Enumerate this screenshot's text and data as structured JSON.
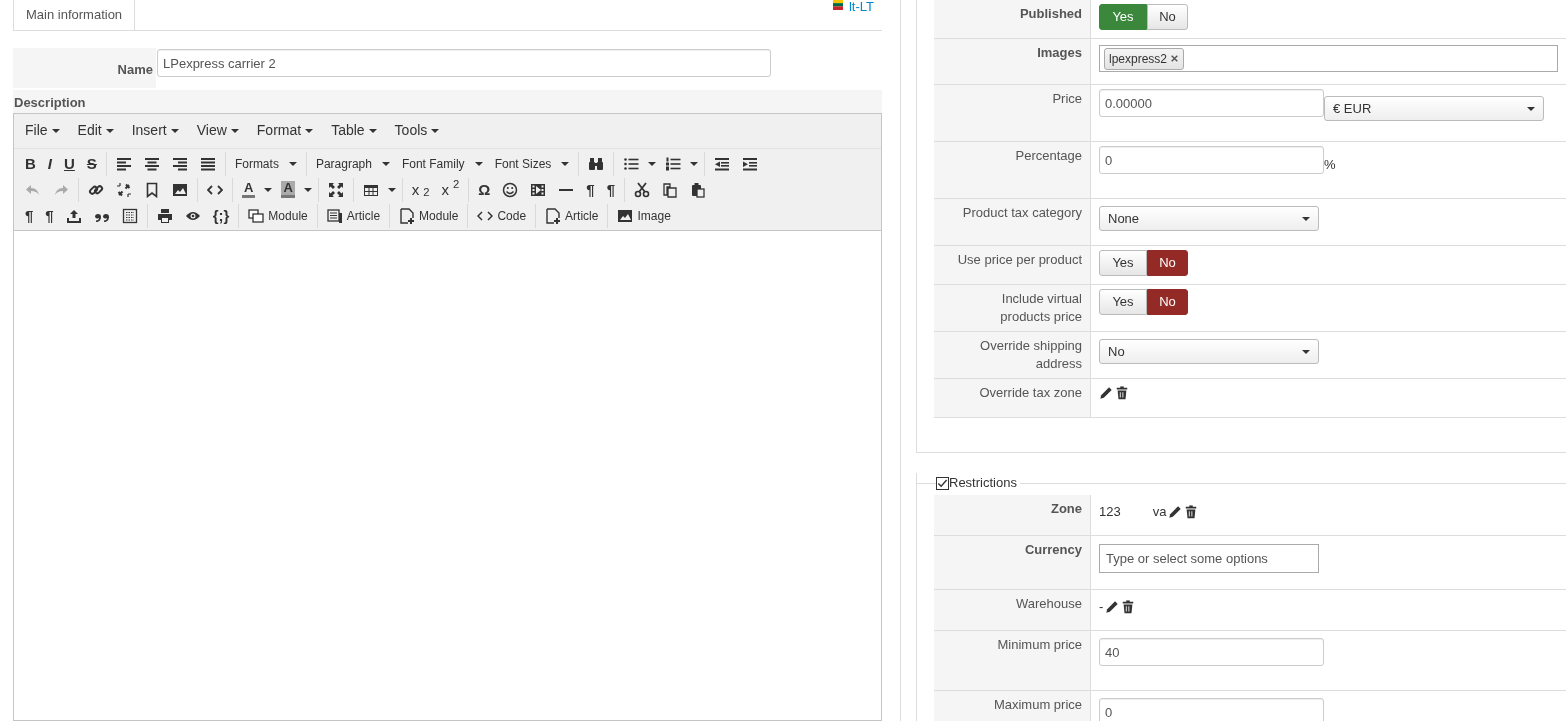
{
  "tabs": [
    {
      "label": "Main information",
      "selected": true
    }
  ],
  "language": {
    "code": "lt-LT"
  },
  "name_field": {
    "label": "Name",
    "value": "LPexpress carrier 2"
  },
  "description": {
    "label": "Description"
  },
  "editor": {
    "menus": [
      "File",
      "Edit",
      "Insert",
      "View",
      "Format",
      "Table",
      "Tools"
    ],
    "toolbar": [
      [
        [
          {
            "kind": "glyph",
            "glyph": "B"
          },
          {
            "kind": "glyph",
            "glyph": "I"
          },
          {
            "kind": "glyph",
            "glyph": "U"
          },
          {
            "kind": "glyph",
            "glyph": "S"
          }
        ],
        [
          {
            "kind": "icon"
          },
          {
            "kind": "icon"
          },
          {
            "kind": "icon"
          },
          {
            "kind": "icon"
          }
        ],
        [
          {
            "kind": "menu",
            "label": "Formats"
          }
        ],
        [
          {
            "kind": "menu",
            "label": "Paragraph"
          },
          {
            "kind": "menu",
            "label": "Font Family"
          },
          {
            "kind": "menu",
            "label": "Font Sizes"
          }
        ],
        [
          {
            "kind": "icon"
          }
        ],
        [
          {
            "kind": "icon",
            "caret": true
          },
          {
            "kind": "icon",
            "caret": true
          }
        ],
        [
          {
            "kind": "icon"
          },
          {
            "kind": "icon"
          }
        ]
      ],
      [
        [
          {
            "kind": "icon",
            "disabled": true
          },
          {
            "kind": "icon",
            "disabled": true
          }
        ],
        [
          {
            "kind": "icon"
          },
          {
            "kind": "icon"
          },
          {
            "kind": "icon"
          },
          {
            "kind": "icon"
          }
        ],
        [
          {
            "kind": "icon"
          }
        ],
        [
          {
            "kind": "color",
            "glyph": "A",
            "filled": false
          },
          {
            "kind": "color",
            "glyph": "A",
            "filled": true
          }
        ],
        [
          {
            "kind": "icon"
          }
        ],
        [
          {
            "kind": "icon",
            "caret": true
          }
        ],
        [
          {
            "kind": "glyph",
            "glyph": "x$_{2}$"
          },
          {
            "kind": "glyph",
            "glyph": "x$^{2}$"
          }
        ],
        [
          {
            "kind": "glyph",
            "glyph": "Ω"
          },
          {
            "kind": "icon"
          },
          {
            "kind": "icon"
          },
          {
            "kind": "icon"
          },
          {
            "kind": "glyph",
            "glyph": "¶"
          },
          {
            "kind": "glyph",
            "glyph": "¶"
          }
        ],
        [
          {
            "kind": "icon"
          },
          {
            "kind": "icon"
          },
          {
            "kind": "icon"
          }
        ]
      ],
      [
        [
          {
            "kind": "glyph",
            "glyph": "¶"
          },
          {
            "kind": "glyph",
            "glyph": "¶"
          },
          {
            "kind": "icon"
          },
          {
            "kind": "icon"
          },
          {
            "kind": "icon"
          }
        ],
        [
          {
            "kind": "icon"
          },
          {
            "kind": "icon"
          },
          {
            "kind": "glyph",
            "glyph": "{;}"
          }
        ],
        [
          {
            "kind": "labeled",
            "label": "Module"
          }
        ],
        [
          {
            "kind": "labeled",
            "label": "Article"
          }
        ],
        [
          {
            "kind": "labeled",
            "label": "Module"
          }
        ],
        [
          {
            "kind": "labeled",
            "label": "Code"
          }
        ],
        [
          {
            "kind": "labeled",
            "label": "Article"
          }
        ],
        [
          {
            "kind": "labeled",
            "label": "Image"
          }
        ]
      ]
    ]
  },
  "settings": [
    {
      "label": "Published",
      "bold": true,
      "kind": "toggle",
      "options": [
        {
          "label": "Yes",
          "selected": true
        },
        {
          "label": "No",
          "selected": false
        }
      ]
    },
    {
      "label": "Images",
      "bold": true,
      "kind": "tags",
      "tags": [
        "lpexpress2"
      ]
    },
    {
      "label": "Price",
      "bold": false,
      "kind": "price",
      "value": "0.00000",
      "currency": "€ EUR"
    },
    {
      "label": "Percentage",
      "bold": false,
      "kind": "percent",
      "value": "0",
      "suffix": "%"
    },
    {
      "label": "Product tax category",
      "bold": false,
      "kind": "select",
      "value": "None"
    },
    {
      "label": "Use price per product",
      "bold": false,
      "kind": "toggle",
      "options": [
        {
          "label": "Yes",
          "selected": false
        },
        {
          "label": "No",
          "selected": true
        }
      ]
    },
    {
      "label": "Include virtual products price",
      "bold": false,
      "kind": "toggle",
      "options": [
        {
          "label": "Yes",
          "selected": false
        },
        {
          "label": "No",
          "selected": true
        }
      ]
    },
    {
      "label": "Override shipping address",
      "bold": false,
      "kind": "select",
      "value": "No"
    },
    {
      "label": "Override tax zone",
      "bold": false,
      "kind": "actions"
    }
  ],
  "restrictions": {
    "label": "Restrictions",
    "checked": true,
    "rows": [
      {
        "label": "Zone",
        "bold": true,
        "kind": "actions",
        "texts": [
          "123",
          "va"
        ]
      },
      {
        "label": "Currency",
        "bold": true,
        "kind": "input",
        "placeholder": "Type or select some options"
      },
      {
        "label": "Warehouse",
        "bold": false,
        "kind": "actions",
        "texts": [
          "-"
        ]
      },
      {
        "label": "Minimum price",
        "bold": false,
        "kind": "input",
        "value": "40"
      },
      {
        "label": "Maximum price",
        "bold": false,
        "kind": "input",
        "value": "0"
      }
    ]
  }
}
